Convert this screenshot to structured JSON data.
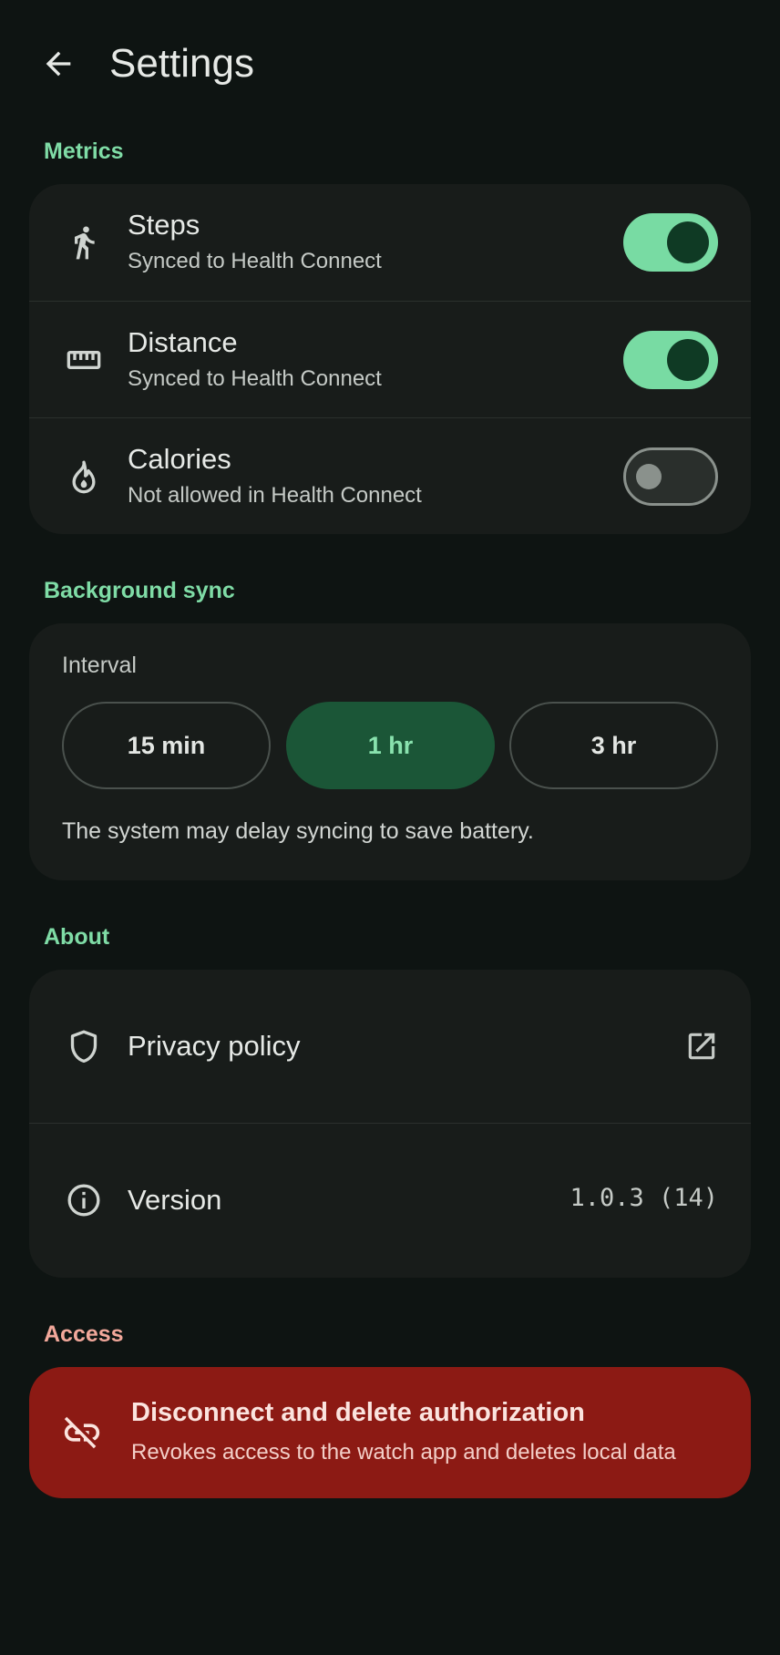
{
  "header": {
    "title": "Settings"
  },
  "sections": {
    "metrics": "Metrics",
    "background_sync": "Background sync",
    "about": "About",
    "access": "Access"
  },
  "metrics": [
    {
      "icon": "walk-icon",
      "title": "Steps",
      "subtitle": "Synced to Health Connect",
      "enabled": true
    },
    {
      "icon": "ruler-icon",
      "title": "Distance",
      "subtitle": "Synced to Health Connect",
      "enabled": true
    },
    {
      "icon": "flame-icon",
      "title": "Calories",
      "subtitle": "Not allowed in Health Connect",
      "enabled": false
    }
  ],
  "sync": {
    "interval_label": "Interval",
    "options": [
      "15 min",
      "1 hr",
      "3 hr"
    ],
    "selected": "1 hr",
    "note": "The system may delay syncing to save battery."
  },
  "about": {
    "privacy_label": "Privacy policy",
    "version_label": "Version",
    "version_value": "1.0.3 (14)"
  },
  "access": {
    "title": "Disconnect and delete authorization",
    "subtitle": "Revokes access to the watch app and deletes local data"
  },
  "colors": {
    "background": "#0e1412",
    "card": "#181c1a",
    "accent": "#78dba3",
    "danger": "#8c1a14"
  }
}
